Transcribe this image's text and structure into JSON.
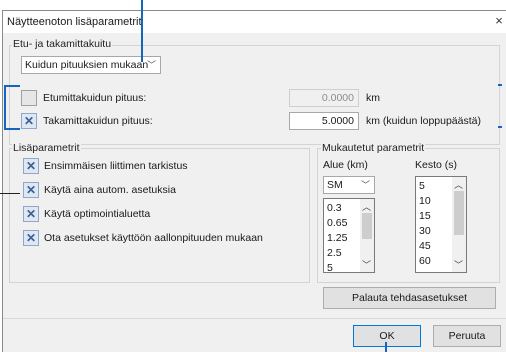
{
  "window": {
    "title": "Näytteenoton lisäparametrit",
    "close_glyph": "×"
  },
  "end_section": {
    "label": "Etu- ja takamittakuitu",
    "mode_select": "Kuidun pituuksien mukaan",
    "front": {
      "label": "Etumittakuidun pituus:",
      "checked": false,
      "value": "0.0000",
      "unit": "km"
    },
    "back": {
      "label": "Takamittakuidun pituus:",
      "checked": true,
      "value": "5.0000",
      "unit": "km (kuidun loppupäästä)"
    }
  },
  "extra_section": {
    "label": "Lisäparametrit",
    "options": [
      {
        "label": "Ensimmäisen liittimen tarkistus",
        "checked": true
      },
      {
        "label": "Käytä aina autom. asetuksia",
        "checked": true
      },
      {
        "label": "Käytä optimointialuetta",
        "checked": true
      },
      {
        "label": "Ota asetukset käyttöön aallonpituuden mukaan",
        "checked": true
      }
    ]
  },
  "custom_section": {
    "label": "Mukautetut parametrit",
    "range_header": "Alue (km)",
    "duration_header": "Kesto (s)",
    "mode_select": "SM",
    "range_items": [
      "0.3",
      "0.65",
      "1.25",
      "2.5",
      "5"
    ],
    "duration_items": [
      "5",
      "10",
      "15",
      "30",
      "45",
      "60"
    ],
    "restore_button": "Palauta tehdasasetukset"
  },
  "footer": {
    "ok": "OK",
    "cancel": "Peruuta"
  },
  "colors": {
    "accent": "#0078d7",
    "checkbox": "#3a5f96",
    "annotation": "#1565c0"
  }
}
